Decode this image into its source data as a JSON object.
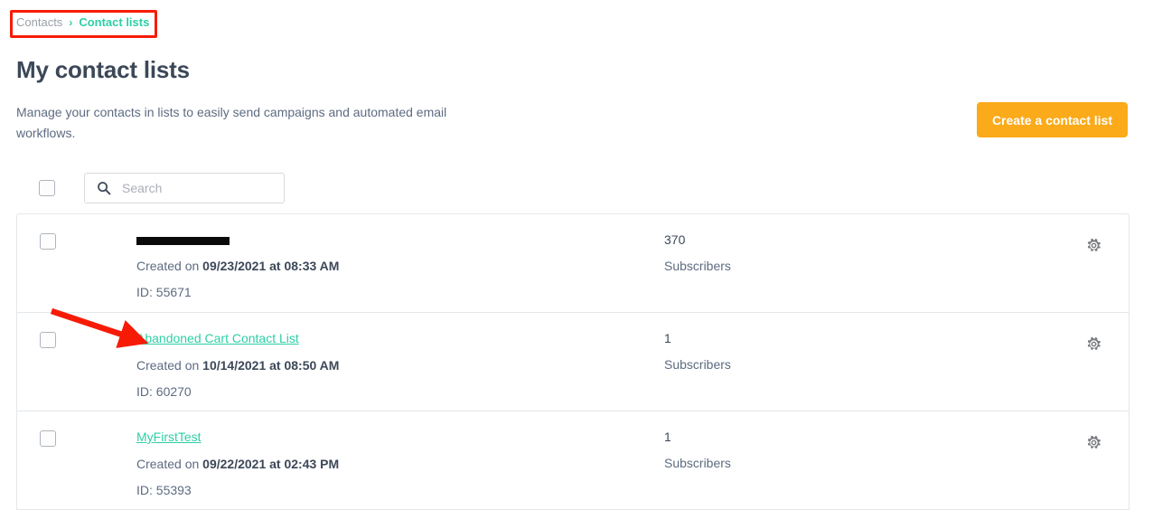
{
  "breadcrumb": {
    "root": "Contacts",
    "separator": "›",
    "current": "Contact lists"
  },
  "page": {
    "title": "My contact lists",
    "intro": "Manage your contacts in lists to easily send campaigns and automated email workflows."
  },
  "actions": {
    "create_label": "Create a contact list"
  },
  "toolbar": {
    "select_all_checkbox": "",
    "search_placeholder": "Search",
    "search_value": "",
    "search_icon": "search-icon"
  },
  "colors": {
    "accent_teal": "#2ecfa6",
    "button_orange": "#fbaa19",
    "annotation_red": "#f71b06",
    "text_dark": "#3c4858",
    "text_muted": "#5d6b80",
    "border": "#e4e7ea"
  },
  "list_rows": [
    {
      "name": "",
      "redacted": true,
      "created_prefix": "Created on ",
      "created_value": "09/23/2021 at 08:33 AM",
      "id_label": "ID: 55671",
      "subscribers_count": "370",
      "subscribers_label": "Subscribers",
      "gear_icon": "gear-icon"
    },
    {
      "name": "Abandoned Cart Contact List",
      "redacted": false,
      "created_prefix": "Created on ",
      "created_value": "10/14/2021 at 08:50 AM",
      "id_label": "ID: 60270",
      "subscribers_count": "1",
      "subscribers_label": "Subscribers",
      "gear_icon": "gear-icon"
    },
    {
      "name": "MyFirstTest",
      "redacted": false,
      "created_prefix": "Created on ",
      "created_value": "09/22/2021 at 02:43 PM",
      "id_label": "ID: 55393",
      "subscribers_count": "1",
      "subscribers_label": "Subscribers",
      "gear_icon": "gear-icon"
    }
  ],
  "annotations": {
    "breadcrumb_highlight": "red-rectangle",
    "arrow_to_list_name": "red-arrow"
  }
}
